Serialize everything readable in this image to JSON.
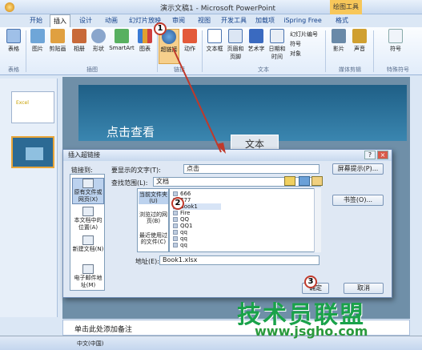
{
  "window": {
    "title": "演示文稿1 - Microsoft PowerPoint",
    "context_tab": "绘图工具"
  },
  "tabs": [
    {
      "label": "开始"
    },
    {
      "label": "插入"
    },
    {
      "label": "设计"
    },
    {
      "label": "动画"
    },
    {
      "label": "幻灯片放映"
    },
    {
      "label": "审阅"
    },
    {
      "label": "视图"
    },
    {
      "label": "开发工具"
    },
    {
      "label": "加载项"
    },
    {
      "label": "iSpring Free"
    },
    {
      "label": "格式"
    }
  ],
  "ribbon": {
    "buttons": [
      {
        "label": "表格"
      },
      {
        "label": "图片"
      },
      {
        "label": "剪贴画"
      },
      {
        "label": "相册"
      },
      {
        "label": "形状"
      },
      {
        "label": "SmartArt"
      },
      {
        "label": "图表"
      },
      {
        "label": "超链接"
      },
      {
        "label": "动作"
      },
      {
        "label": "文本框"
      },
      {
        "label": "页眉和页脚"
      },
      {
        "label": "艺术字"
      },
      {
        "label": "日期和时间"
      },
      {
        "label": "影片"
      },
      {
        "label": "声音"
      },
      {
        "label": "符号"
      }
    ],
    "small_buttons": [
      {
        "label": "幻灯片编号"
      },
      {
        "label": "符号"
      },
      {
        "label": "对象"
      }
    ],
    "groups": [
      {
        "label": "表格"
      },
      {
        "label": "插图"
      },
      {
        "label": "链接"
      },
      {
        "label": "文本"
      },
      {
        "label": "媒体剪辑"
      },
      {
        "label": "特殊符号"
      }
    ]
  },
  "slide": {
    "placeholder": "点击查看",
    "textbox": "文本"
  },
  "notes": {
    "placeholder": "单击此处添加备注"
  },
  "status": {
    "text": "中文(中国)"
  },
  "thumb_text": "Excel",
  "dialog": {
    "title": "插入超链接",
    "link_to_label": "链接到:",
    "display_text_label": "要显示的文字(T):",
    "display_text_value": "点击",
    "screen_tip_button": "屏幕提示(P)...",
    "look_in_label": "查找范围(L):",
    "look_in_value": "文档",
    "bookmark_button": "书签(O)...",
    "address_label": "地址(E):",
    "address_value": "Book1.xlsx",
    "ok_button": "确定",
    "cancel_button": "取消",
    "nav": [
      {
        "label": "原有文件或网页(X)"
      },
      {
        "label": "本文档中的位置(A)"
      },
      {
        "label": "新建文档(N)"
      },
      {
        "label": "电子邮件地址(M)"
      }
    ],
    "mid": [
      {
        "label": "当前文件夹(U)"
      },
      {
        "label": "浏览过的网页(B)"
      },
      {
        "label": "最近使用过的文件(C)"
      }
    ],
    "files": [
      {
        "name": "666"
      },
      {
        "name": "777"
      },
      {
        "name": "Book1"
      },
      {
        "name": "Fire"
      },
      {
        "name": "QQ"
      },
      {
        "name": "QQ1"
      },
      {
        "name": "qq"
      },
      {
        "name": "qq"
      },
      {
        "name": "qq"
      }
    ]
  },
  "annotations": [
    {
      "label": "1"
    },
    {
      "label": "2"
    },
    {
      "label": "3"
    }
  ],
  "watermark": {
    "text": "技术员联盟",
    "url": "www.jsgho.com"
  }
}
